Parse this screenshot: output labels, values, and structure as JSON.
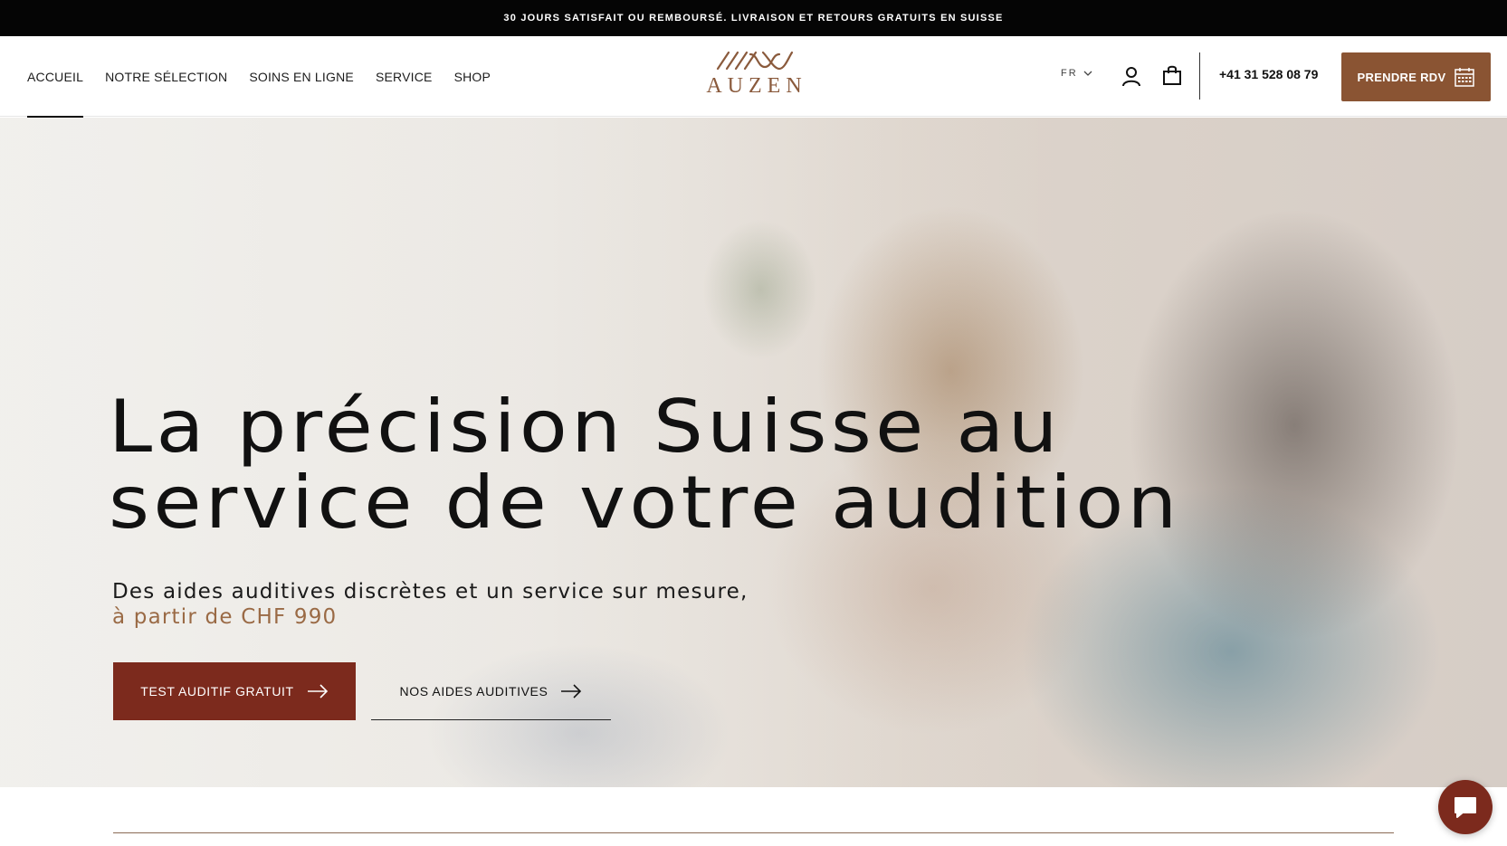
{
  "announcement": {
    "text": "30 JOURS SATISFAIT OU REMBOURSÉ. LIVRAISON ET RETOURS GRATUITS EN SUISSE"
  },
  "header": {
    "nav": [
      {
        "label": "ACCUEIL",
        "active": true
      },
      {
        "label": "NOTRE SÉLECTION",
        "active": false
      },
      {
        "label": "SOINS EN LIGNE",
        "active": false
      },
      {
        "label": "SERVICE",
        "active": false
      },
      {
        "label": "SHOP",
        "active": false
      }
    ],
    "logo_text": "AUZEN",
    "language": "FR",
    "icons": {
      "language": "chevron-down-icon",
      "account": "user-icon",
      "cart": "shopping-bag-icon",
      "calendar": "calendar-icon"
    },
    "phone": "+41 31 528 08 79",
    "cta_label": "PRENDRE RDV"
  },
  "hero": {
    "title_line1": "La précision Suisse au",
    "title_line2": "service de votre audition",
    "subtitle": "Des aides auditives discrètes et un service sur mesure,",
    "price_line": "à partir de CHF 990",
    "primary_button": "TEST AUDITIF GRATUIT",
    "secondary_button": "NOS AIDES AUDITIVES"
  },
  "colors": {
    "brand_brown": "#8a5433",
    "button_red": "#7c2a1d",
    "price_accent": "#9a6a45",
    "announcement_bg": "#050505"
  },
  "chat": {
    "icon": "chat-bubble-icon"
  }
}
